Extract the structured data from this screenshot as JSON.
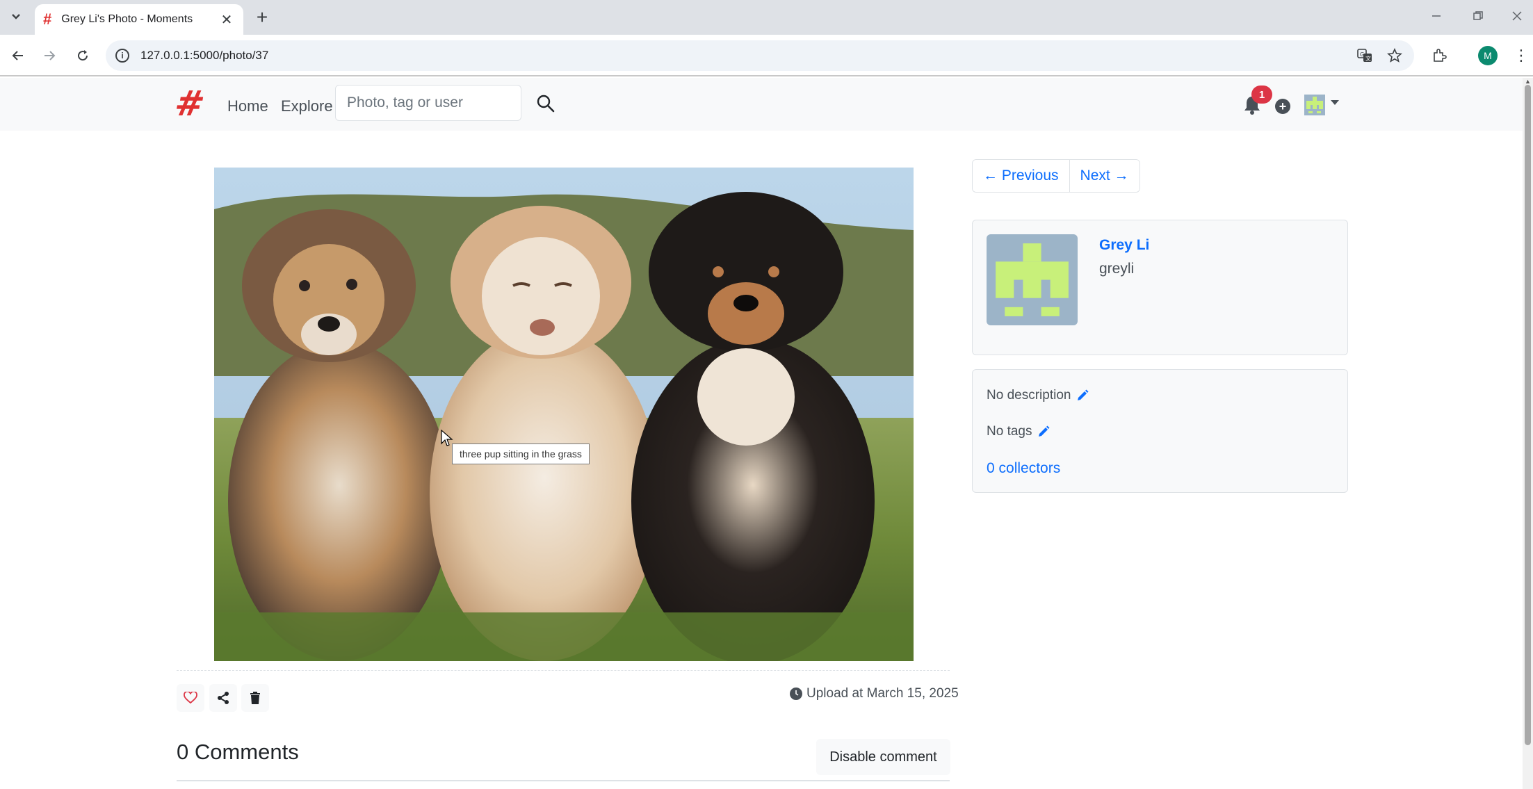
{
  "browser": {
    "tab_title": "Grey Li's Photo - Moments",
    "url": "127.0.0.1:5000/photo/37",
    "profile_initial": "M"
  },
  "nav": {
    "brand": "#",
    "home": "Home",
    "explore": "Explore",
    "search_placeholder": "Photo, tag or user",
    "notification_count": "1"
  },
  "photo": {
    "tooltip": "three pup sitting in the grass",
    "upload_text": "Upload at March 15, 2025"
  },
  "comments": {
    "title": "0 Comments",
    "disable_label": "Disable comment"
  },
  "pager": {
    "previous": "← Previous",
    "next": "Next →"
  },
  "user": {
    "name": "Grey Li",
    "username": "greyli"
  },
  "info": {
    "description": "No description",
    "tags": "No tags",
    "collectors": "0 collectors"
  },
  "colors": {
    "brand": "#e03131",
    "link": "#0d6efd",
    "badge": "#dc3545",
    "identicon_bg": "#9cb4c8",
    "identicon_fg": "#c8f07a"
  }
}
